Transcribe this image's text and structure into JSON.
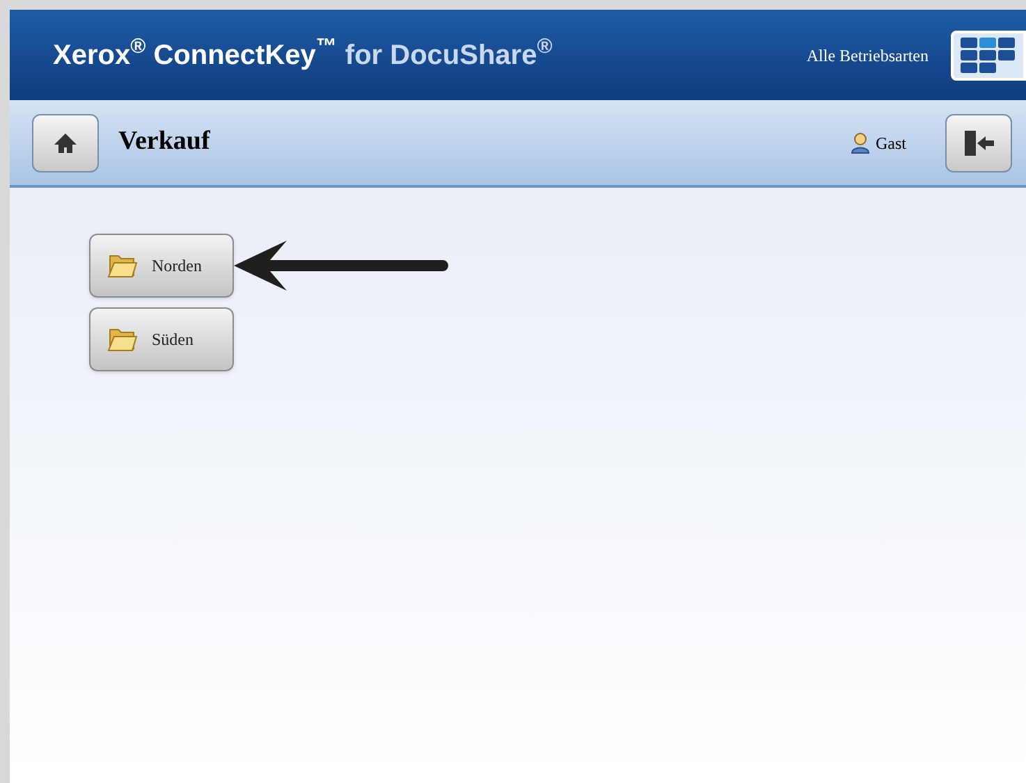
{
  "header": {
    "brand": "Xerox$^{®}$ ConnectKey$^{™}$",
    "product": "for DocuShare$^{®}$",
    "mode_label": "Alle Betriebsarten"
  },
  "toolbar": {
    "title": "Verkauf",
    "user": "Gast"
  },
  "folders": [
    {
      "label": "Norden",
      "pointed": true
    },
    {
      "label": "Süden",
      "pointed": false
    }
  ]
}
